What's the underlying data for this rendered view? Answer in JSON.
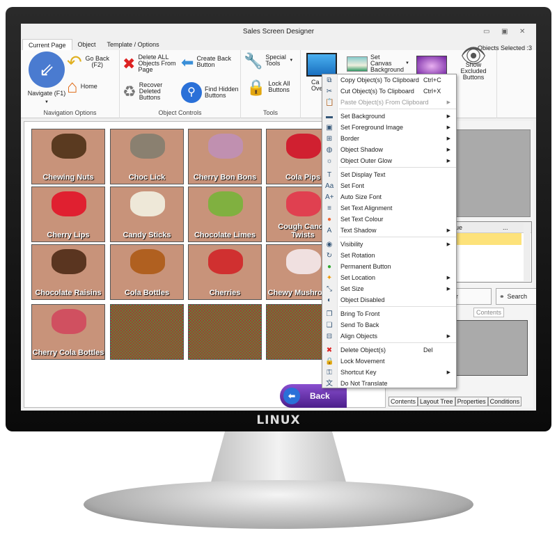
{
  "window": {
    "title": "Sales Screen Designer",
    "objects_selected": "Objects Selected :3"
  },
  "tabs": [
    "Current Page",
    "Object",
    "Template / Options"
  ],
  "ribbon": {
    "navigation": {
      "label": "Navigation Options",
      "navigate": "Navigate (F1)",
      "go_back": "Go Back (F2)",
      "home": "Home"
    },
    "object_controls": {
      "label": "Object Controls",
      "delete_all": "Delete ALL Objects From Page",
      "create_back": "Create Back Button",
      "recover": "Recover Deleted Buttons",
      "find_hidden": "Find Hidden Buttons"
    },
    "tools": {
      "label": "Tools",
      "special": "Special Tools",
      "lock_all": "Lock All Buttons"
    },
    "view": {
      "canvas_partial": "Ca Ove",
      "set_canvas_bg": "Set Canvas Background",
      "show_excluded": "Show Excluded Buttons",
      "label_partial": "w"
    }
  },
  "tiles": [
    "Chewing Nuts",
    "Choc Lick",
    "Cherry Bon Bons",
    "Cola Pips",
    "Cherry Lips",
    "Candy Sticks",
    "Chocolate Limes",
    "Cough Candy Twists",
    "Chocolate Raisins",
    "Cola Bottles",
    "Cherries",
    "Chewy Mushrooms",
    "Cherry Cola Bottles"
  ],
  "back_button": "Back",
  "context_menu": [
    {
      "label": "Copy Object(s) To Clipboard",
      "shortcut": "Ctrl+C",
      "icon": "copy-icon"
    },
    {
      "label": "Cut Object(s) To Clipboard",
      "shortcut": "Ctrl+X",
      "icon": "cut-icon"
    },
    {
      "label": "Paste Object(s) From Clipboard",
      "disabled": true,
      "sub": true,
      "icon": "paste-icon"
    },
    {
      "sep": true
    },
    {
      "label": "Set Background",
      "sub": true,
      "icon": "image-icon"
    },
    {
      "label": "Set Foreground Image",
      "sub": true,
      "icon": "foreground-image-icon"
    },
    {
      "label": "Border",
      "sub": true,
      "icon": "border-icon"
    },
    {
      "label": "Object Shadow",
      "sub": true,
      "icon": "shadow-icon"
    },
    {
      "label": "Object Outer Glow",
      "sub": true,
      "icon": "glow-icon"
    },
    {
      "sep": true
    },
    {
      "label": "Set Display Text",
      "icon": "text-icon"
    },
    {
      "label": "Set Font",
      "icon": "font-icon"
    },
    {
      "label": "Auto Size Font",
      "icon": "auto-size-font-icon"
    },
    {
      "label": "Set Text Alignment",
      "icon": "align-text-icon"
    },
    {
      "label": "Set Text Colour",
      "icon": "colour-icon"
    },
    {
      "label": "Text Shadow",
      "sub": true,
      "icon": "text-shadow-icon"
    },
    {
      "sep": true
    },
    {
      "label": "Visibility",
      "sub": true,
      "icon": "eye-icon"
    },
    {
      "label": "Set Rotation",
      "icon": "rotate-icon"
    },
    {
      "label": "Permanent Button",
      "icon": "permanent-icon"
    },
    {
      "label": "Set Location",
      "sub": true,
      "icon": "location-icon"
    },
    {
      "label": "Set Size",
      "sub": true,
      "icon": "size-icon"
    },
    {
      "label": "Object Disabled",
      "icon": "disabled-icon"
    },
    {
      "sep": true
    },
    {
      "label": "Bring To Front",
      "icon": "bring-front-icon"
    },
    {
      "label": "Send To Back",
      "icon": "send-back-icon"
    },
    {
      "label": "Align Objects",
      "sub": true,
      "icon": "align-objects-icon"
    },
    {
      "sep": true
    },
    {
      "label": "Delete Object(s)",
      "shortcut": "Del",
      "icon": "delete-icon"
    },
    {
      "label": "Lock Movement",
      "icon": "lock-icon"
    },
    {
      "label": "Shortcut Key",
      "sub": true,
      "icon": "key-icon"
    },
    {
      "label": "Do Not Translate",
      "icon": "translate-icon"
    }
  ],
  "right_panel": {
    "col_value": "lue",
    "col_more": "...",
    "btn_partial": "r",
    "search": "Search",
    "contents_tab": "Contents",
    "bottom_tabs": [
      "Contents",
      "Layout Tree",
      "Properties",
      "Conditions"
    ]
  },
  "monitor_logo": "LINUX"
}
